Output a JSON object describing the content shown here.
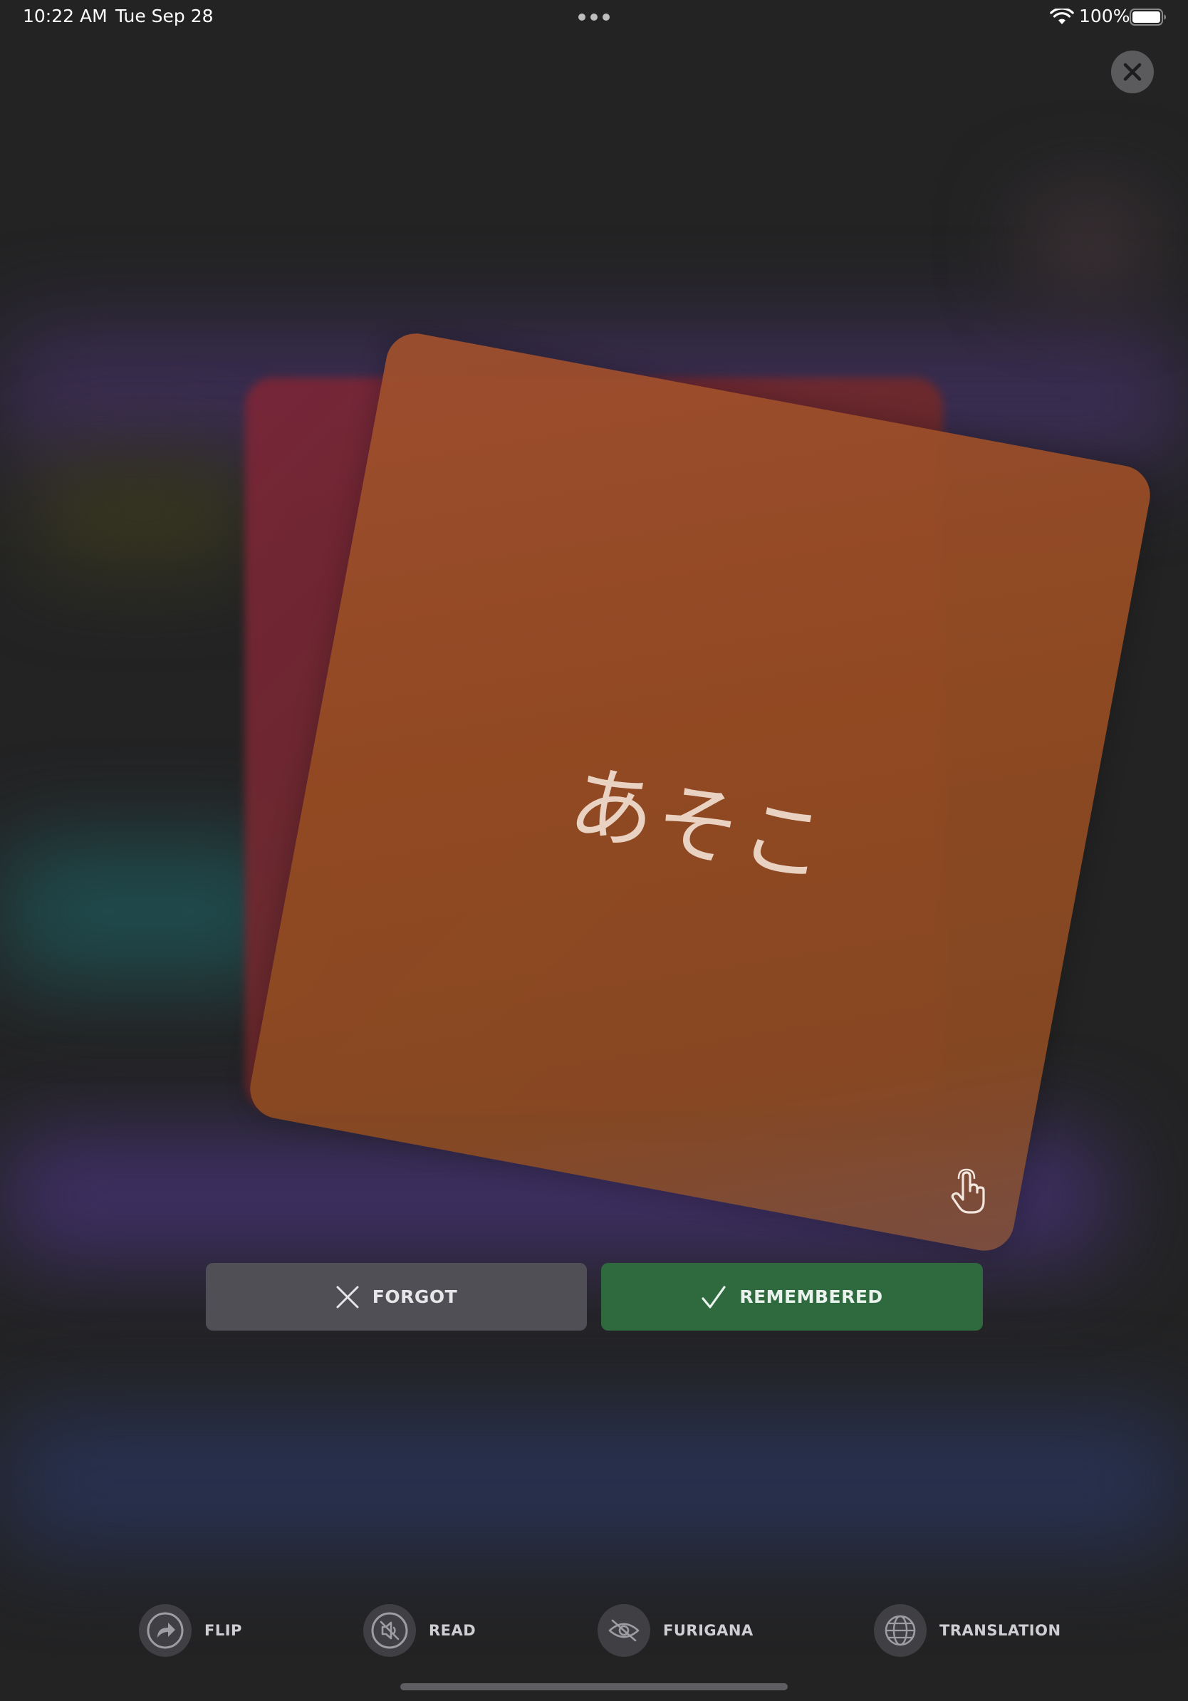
{
  "status_bar": {
    "time": "10:22 AM",
    "date": "Tue Sep 28",
    "battery_percent": "100%",
    "battery_level": 1.0,
    "icons": [
      "multitasking-dots-icon",
      "wifi-icon",
      "battery-icon"
    ]
  },
  "close_button": {
    "icon": "close-icon"
  },
  "card": {
    "text": "あそこ",
    "hint_icon": "tap-hand-icon",
    "color": "#944c22"
  },
  "actions": {
    "forgot": {
      "label": "FORGOT",
      "icon": "x-icon",
      "color": "#4f4f55"
    },
    "remembered": {
      "label": "REMEMBERED",
      "icon": "checkmark-icon",
      "color": "#2f6a3e"
    }
  },
  "toolbar": {
    "items": [
      {
        "label": "FLIP",
        "icon": "flip-arrow-icon"
      },
      {
        "label": "READ",
        "icon": "speaker-muted-icon"
      },
      {
        "label": "FURIGANA",
        "icon": "eye-slash-icon"
      },
      {
        "label": "TRANSLATION",
        "icon": "globe-icon"
      }
    ]
  }
}
